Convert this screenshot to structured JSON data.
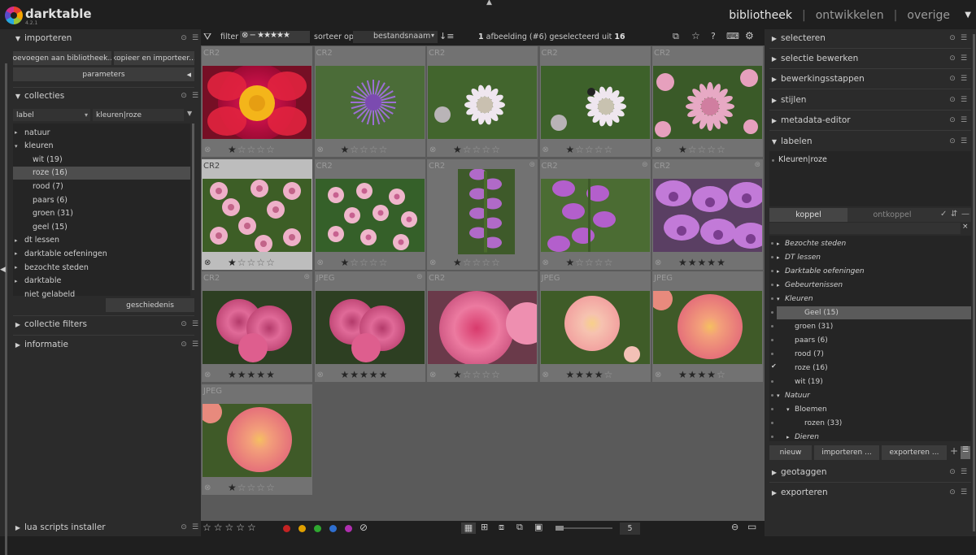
{
  "app": {
    "name": "darktable",
    "version": "4.2.1"
  },
  "views": {
    "active": "bibliotheek",
    "items": [
      "bibliotheek",
      "ontwikkelen",
      "overige"
    ],
    "sep": "|"
  },
  "left": {
    "importeren": {
      "title": "importeren",
      "btn_add": "toevoegen aan bibliotheek...",
      "btn_copy": "kopieer en importeer...",
      "btn_params": "parameters"
    },
    "collecties": {
      "title": "collecties",
      "label_combo": "label",
      "value_combo": "kleuren|roze",
      "tree": [
        {
          "label": "natuur",
          "arrow": "▸",
          "level": 0
        },
        {
          "label": "kleuren",
          "arrow": "▾",
          "level": 0
        },
        {
          "label": "wit (19)",
          "level": 1
        },
        {
          "label": "roze (16)",
          "level": 1,
          "selected": true
        },
        {
          "label": "rood (7)",
          "level": 1
        },
        {
          "label": "paars (6)",
          "level": 1
        },
        {
          "label": "groen (31)",
          "level": 1
        },
        {
          "label": "geel (15)",
          "level": 1
        },
        {
          "label": "dt lessen",
          "arrow": "▸",
          "level": 0
        },
        {
          "label": "darktable oefeningen",
          "arrow": "▸",
          "level": 0
        },
        {
          "label": "bezochte steden",
          "arrow": "▸",
          "level": 0
        },
        {
          "label": "darktable",
          "arrow": "▸",
          "level": 0
        },
        {
          "label": "niet gelabeld",
          "level": 0
        }
      ],
      "history_btn": "geschiedenis"
    },
    "collectie_filters": "collectie filters",
    "informatie": "informatie",
    "lua": "lua scripts installer"
  },
  "filterbar": {
    "filter_label": "filter",
    "sort_label": "sorteer op",
    "sort_value": "bestandsnaam",
    "selection_count": "1",
    "selection_text": "afbeelding (#6) geselecteerd uit",
    "total": "16"
  },
  "thumbnails": [
    {
      "ext": "CR2",
      "rating": 1,
      "img": "peony"
    },
    {
      "ext": "CR2",
      "rating": 1,
      "img": "cornflower"
    },
    {
      "ext": "CR2",
      "rating": 1,
      "img": "astrantia_white"
    },
    {
      "ext": "CR2",
      "rating": 1,
      "img": "astrantia_white2"
    },
    {
      "ext": "CR2",
      "rating": 1,
      "img": "astrantia_pink"
    },
    {
      "ext": "CR2",
      "rating": 1,
      "img": "astrantia_group",
      "selected": true
    },
    {
      "ext": "CR2",
      "rating": 1,
      "img": "astrantia_group2"
    },
    {
      "ext": "CR2",
      "rating": 1,
      "img": "foxglove_tall",
      "grouped": true
    },
    {
      "ext": "CR2",
      "rating": 1,
      "img": "foxglove",
      "grouped": true
    },
    {
      "ext": "CR2",
      "rating": 5,
      "img": "foxglove_close",
      "grouped": true
    },
    {
      "ext": "CR2",
      "rating": 5,
      "img": "rose_pink",
      "grouped": true
    },
    {
      "ext": "JPEG",
      "rating": 5,
      "img": "rose_pink",
      "grouped": true
    },
    {
      "ext": "CR2",
      "rating": 1,
      "img": "rose_big"
    },
    {
      "ext": "JPEG",
      "rating": 4,
      "img": "rose_peach"
    },
    {
      "ext": "JPEG",
      "rating": 4,
      "img": "rose_salmon"
    },
    {
      "ext": "JPEG",
      "rating": 1,
      "img": "rose_salmon"
    }
  ],
  "bottombar": {
    "stars": "☆☆☆☆☆",
    "zoom": "5",
    "colors": [
      "#c42323",
      "#e0a000",
      "#2fa830",
      "#2f6fd0",
      "#b02fb0"
    ]
  },
  "right": {
    "modules": [
      "selecteren",
      "selectie bewerken",
      "bewerkingsstappen",
      "stijlen",
      "metadata-editor",
      "labelen"
    ],
    "attached_tag": "Kleuren|roze",
    "tab_attach": "koppel",
    "tab_detach": "ontkoppel",
    "tags": [
      {
        "label": "Bezochte steden",
        "arrow": "▸",
        "level": 0,
        "italic": true
      },
      {
        "label": "DT lessen",
        "arrow": "▸",
        "level": 0,
        "italic": true
      },
      {
        "label": "Darktable oefeningen",
        "arrow": "▸",
        "level": 0,
        "italic": true
      },
      {
        "label": "Gebeurtenissen",
        "arrow": "▸",
        "level": 0,
        "italic": true
      },
      {
        "label": "Kleuren",
        "arrow": "▾",
        "level": 0,
        "italic": true
      },
      {
        "label": "Geel (15)",
        "level": 1,
        "selected": true
      },
      {
        "label": "groen (31)",
        "level": 1
      },
      {
        "label": "paars (6)",
        "level": 1
      },
      {
        "label": "rood (7)",
        "level": 1
      },
      {
        "label": "roze (16)",
        "level": 1,
        "check": true
      },
      {
        "label": "wit (19)",
        "level": 1
      },
      {
        "label": "Natuur",
        "arrow": "▾",
        "level": 0,
        "italic": true
      },
      {
        "label": "Bloemen",
        "arrow": "▾",
        "level": 1
      },
      {
        "label": "rozen (33)",
        "level": 2
      },
      {
        "label": "Dieren",
        "arrow": "▸",
        "level": 1,
        "italic": true
      }
    ],
    "btn_new": "nieuw",
    "btn_import": "importeren ...",
    "btn_export": "exporteren ...",
    "geotaggen": "geotaggen",
    "exporteren": "exporteren"
  }
}
